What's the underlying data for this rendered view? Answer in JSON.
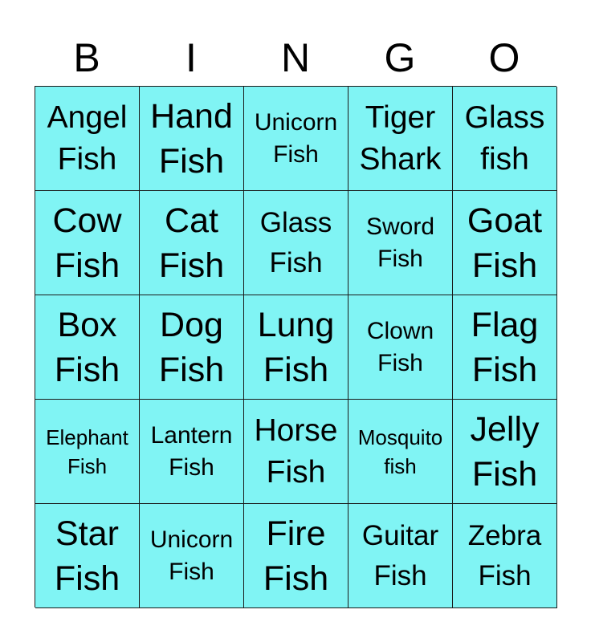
{
  "header": {
    "letters": [
      "B",
      "I",
      "N",
      "G",
      "O"
    ]
  },
  "colors": {
    "cell_background": "#80f4f4",
    "border": "#1a1a1a"
  },
  "cells": [
    [
      "Angel\nFish",
      "Hand\nFish",
      "Unicorn\nFish",
      "Tiger\nShark",
      "Glass\nfish"
    ],
    [
      "Cow\nFish",
      "Cat\nFish",
      "Glass\nFish",
      "Sword\nFish",
      "Goat\nFish"
    ],
    [
      "Box\nFish",
      "Dog\nFish",
      "Lung\nFish",
      "Clown\nFish",
      "Flag\nFish"
    ],
    [
      "Elephant\nFish",
      "Lantern\nFish",
      "Horse\nFish",
      "Mosquito\nfish",
      "Jelly\nFish"
    ],
    [
      "Star\nFish",
      "Unicorn\nFish",
      "Fire\nFish",
      "Guitar\nFish",
      "Zebra\nFish"
    ]
  ]
}
